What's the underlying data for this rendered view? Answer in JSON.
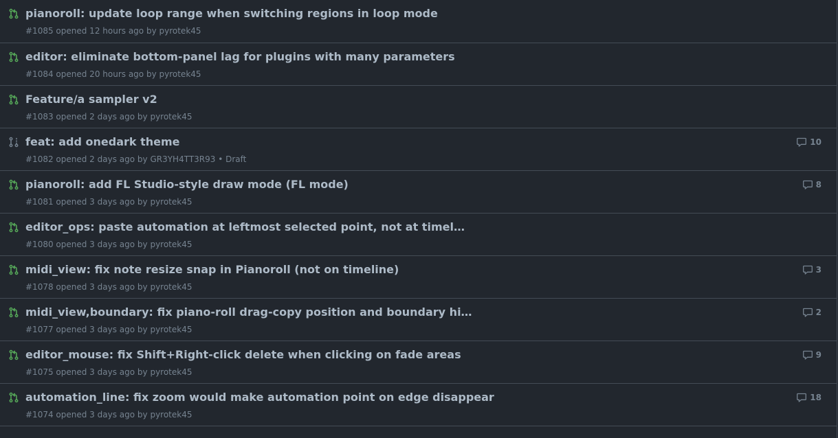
{
  "colors": {
    "open_icon": "#57ab5a",
    "draft_icon": "#768390",
    "title": "#adbac7",
    "meta": "#768390",
    "background": "#22272e",
    "border": "#444c56"
  },
  "pull_requests": [
    {
      "title": "pianoroll: update loop range when switching regions in loop mode",
      "number": "#1085",
      "opened_text": "opened 12 hours ago by",
      "author": "pyrotek45",
      "draft": "",
      "comments": "",
      "state_icon": "git-pull-request-icon"
    },
    {
      "title": "editor: eliminate bottom-panel lag for plugins with many parameters",
      "number": "#1084",
      "opened_text": "opened 20 hours ago by",
      "author": "pyrotek45",
      "draft": "",
      "comments": "",
      "state_icon": "git-pull-request-icon"
    },
    {
      "title": "Feature/a sampler v2",
      "number": "#1083",
      "opened_text": "opened 2 days ago by",
      "author": "pyrotek45",
      "draft": "",
      "comments": "",
      "state_icon": "git-pull-request-icon"
    },
    {
      "title": "feat: add onedark theme",
      "number": "#1082",
      "opened_text": "opened 2 days ago by",
      "author": "GR3YH4TT3R93",
      "draft": "• Draft",
      "comments": "10",
      "state_icon": "git-pull-request-draft-icon"
    },
    {
      "title": "pianoroll: add FL Studio-style draw mode (FL mode)",
      "number": "#1081",
      "opened_text": "opened 3 days ago by",
      "author": "pyrotek45",
      "draft": "",
      "comments": "8",
      "state_icon": "git-pull-request-icon"
    },
    {
      "title": "editor_ops: paste automation at leftmost selected point, not at timel…",
      "number": "#1080",
      "opened_text": "opened 3 days ago by",
      "author": "pyrotek45",
      "draft": "",
      "comments": "",
      "state_icon": "git-pull-request-icon"
    },
    {
      "title": "midi_view: fix note resize snap in Pianoroll (not on timeline)",
      "number": "#1078",
      "opened_text": "opened 3 days ago by",
      "author": "pyrotek45",
      "draft": "",
      "comments": "3",
      "state_icon": "git-pull-request-icon"
    },
    {
      "title": "midi_view,boundary: fix piano-roll drag-copy position and boundary hi…",
      "number": "#1077",
      "opened_text": "opened 3 days ago by",
      "author": "pyrotek45",
      "draft": "",
      "comments": "2",
      "state_icon": "git-pull-request-icon"
    },
    {
      "title": "editor_mouse: fix Shift+Right-click delete when clicking on fade areas",
      "number": "#1075",
      "opened_text": "opened 3 days ago by",
      "author": "pyrotek45",
      "draft": "",
      "comments": "9",
      "state_icon": "git-pull-request-icon"
    },
    {
      "title": "automation_line: fix zoom would make automation point on edge disappear",
      "number": "#1074",
      "opened_text": "opened 3 days ago by",
      "author": "pyrotek45",
      "draft": "",
      "comments": "18",
      "state_icon": "git-pull-request-icon"
    }
  ]
}
